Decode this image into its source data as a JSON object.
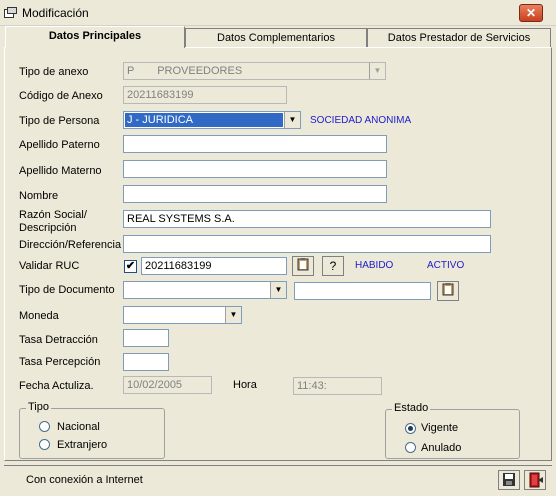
{
  "window": {
    "title": "Modificación",
    "close": "✕"
  },
  "tabs": [
    {
      "label": "Datos Principales"
    },
    {
      "label": "Datos Complementarios"
    },
    {
      "label": "Datos Prestador de Servicios"
    }
  ],
  "form": {
    "tipo_anexo": {
      "label": "Tipo de anexo",
      "code": "P",
      "value": "PROVEEDORES"
    },
    "codigo_anexo": {
      "label": "Código de Anexo",
      "value": "20211683199"
    },
    "tipo_persona": {
      "label": "Tipo de Persona",
      "value": "J - JURIDICA",
      "note": "SOCIEDAD ANONIMA"
    },
    "apellido_paterno": {
      "label": "Apellido Paterno",
      "value": ""
    },
    "apellido_materno": {
      "label": "Apellido Materno",
      "value": ""
    },
    "nombre": {
      "label": "Nombre",
      "value": ""
    },
    "razon_social": {
      "label_line1": "Razón Social/",
      "label_line2": "Descripción",
      "value": "REAL SYSTEMS S.A."
    },
    "direccion": {
      "label": "Dirección/Referencia",
      "value": ""
    },
    "validar_ruc": {
      "label": "Validar RUC",
      "checked": true,
      "check_mark": "✔",
      "value": "20211683199",
      "help": "?",
      "status1": "HABIDO",
      "status2": "ACTIVO"
    },
    "tipo_documento": {
      "label": "Tipo de Documento",
      "value": "",
      "number": ""
    },
    "moneda": {
      "label": "Moneda",
      "value": ""
    },
    "tasa_detraccion": {
      "label": "Tasa Detracción",
      "value": ""
    },
    "tasa_percepcion": {
      "label": "Tasa Percepción",
      "value": ""
    },
    "fecha": {
      "label": "Fecha Actuliza.",
      "value": "10/02/2005",
      "hora_label": "Hora",
      "hora_value": "11:43:"
    }
  },
  "tipo_group": {
    "legend": "Tipo",
    "options": [
      "Nacional",
      "Extranjero"
    ],
    "selected": null
  },
  "estado_group": {
    "legend": "Estado",
    "options": [
      "Vigente",
      "Anulado"
    ],
    "selected": "Vigente"
  },
  "status": {
    "text": "Con conexión a Internet"
  },
  "colors": {
    "accent_blue": "#1c1ccc",
    "selection": "#316ac5",
    "close_red": "#c8401f"
  }
}
